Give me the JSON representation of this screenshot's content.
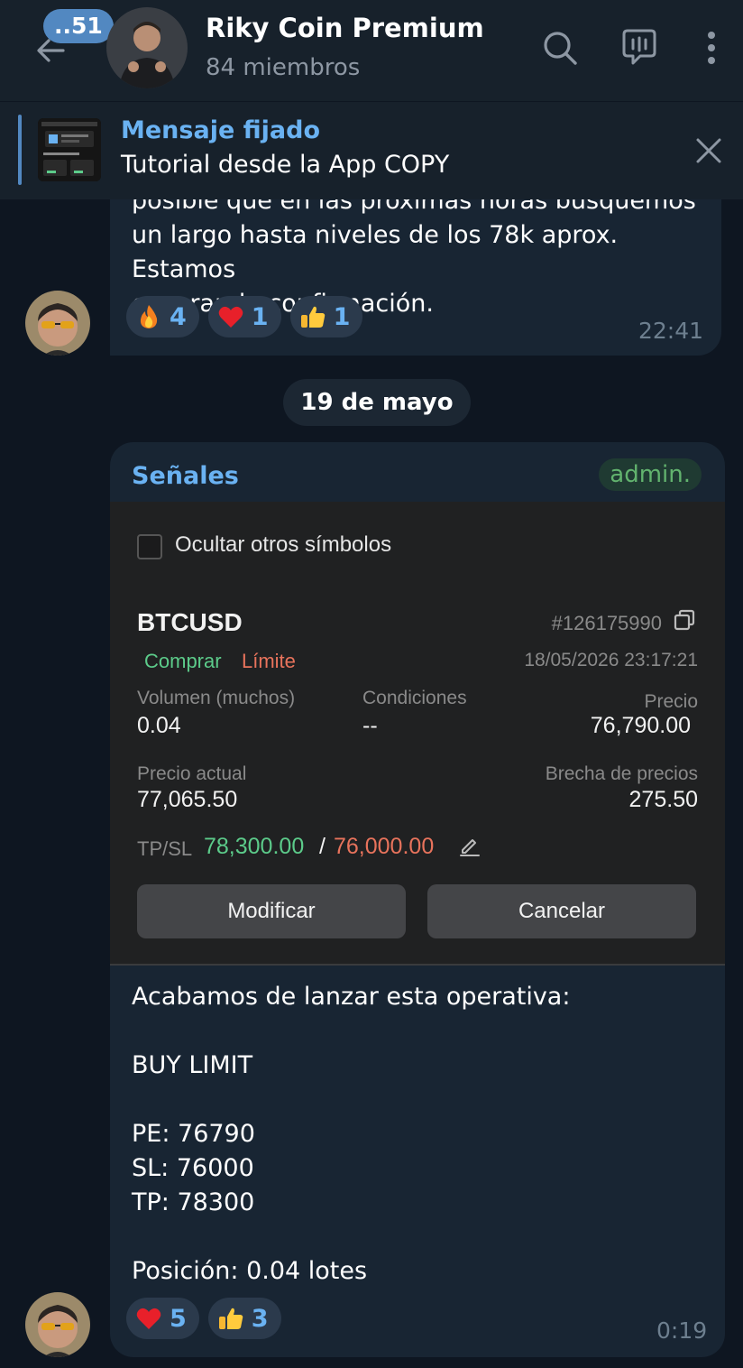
{
  "header": {
    "unread_count": "..51",
    "title": "Riky Coin Premium",
    "subtitle": "84 miembros",
    "icons": [
      "back-arrow-icon",
      "search-icon",
      "live-chat-icon",
      "more-vertical-icon"
    ]
  },
  "pinned": {
    "label": "Mensaje fijado",
    "text": "Tutorial desde la App COPY"
  },
  "messages": [
    {
      "text": "posible que en las próximas horas busquemos\nun largo hasta niveles de los 78k aprox. Estamos\nesperando confirmación.",
      "reactions": [
        {
          "emoji": "fire",
          "count": "4"
        },
        {
          "emoji": "heart",
          "count": "1"
        },
        {
          "emoji": "thumbs-up",
          "count": "1"
        }
      ],
      "time": "22:41"
    },
    {
      "sender": "Señales",
      "badge": "admin.",
      "trade": {
        "hide_others_label": "Ocultar otros símbolos",
        "symbol": "BTCUSD",
        "order_id": "#126175990",
        "side": "Comprar",
        "order_type": "Límite",
        "datetime": "18/05/2026 23:17:21",
        "volume_label": "Volumen (muchos)",
        "volume": "0.04",
        "conditions_label": "Condiciones",
        "conditions": "--",
        "price_label": "Precio",
        "price": "76,790.00",
        "current_price_label": "Precio actual",
        "current_price": "77,065.50",
        "gap_label": "Brecha de precios",
        "gap": "275.50",
        "tpsl_label": "TP/SL",
        "tp": "78,300.00",
        "slash": "/",
        "sl": "76,000.00",
        "modify_label": "Modificar",
        "cancel_label": "Cancelar"
      },
      "text": "Acabamos de lanzar esta operativa:\n\nBUY LIMIT\n\nPE: 76790\nSL: 76000\nTP: 78300\n\nPosición: 0.04 lotes",
      "reactions": [
        {
          "emoji": "heart",
          "count": "5"
        },
        {
          "emoji": "thumbs-up",
          "count": "3"
        }
      ],
      "time": "0:19"
    }
  ],
  "date_separator": "19 de mayo",
  "colors": {
    "background": "#0e1621",
    "header": "#17212b",
    "bubble": "#182533",
    "accent": "#6ab2f2",
    "buy": "#5ccb8a",
    "sell": "#e8735c",
    "admin": "#62b36e"
  }
}
